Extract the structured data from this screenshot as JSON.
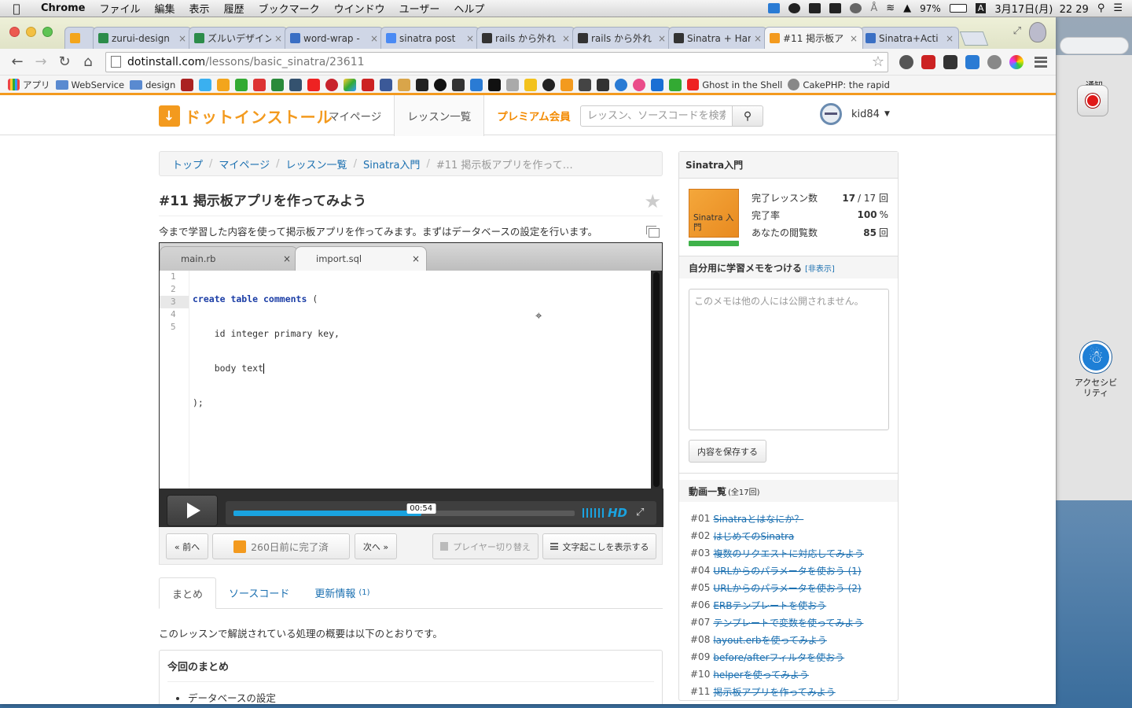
{
  "menubar": {
    "app": "Chrome",
    "items": [
      "ファイル",
      "編集",
      "表示",
      "履歴",
      "ブックマーク",
      "ウインドウ",
      "ユーザー",
      "ヘルプ"
    ],
    "battery": "97%",
    "input_indicator": "A",
    "datetime": "3月17日(月)  22 29"
  },
  "desktop": {
    "notify_label": "通知",
    "accessibility_label": "アクセシビリティ"
  },
  "tabs": [
    {
      "title": "zurui-design",
      "color": "#2c8c4a"
    },
    {
      "title": "ズルいデザイン",
      "color": "#2c8c4a"
    },
    {
      "title": "word-wrap -",
      "color": "#3a6fc4"
    },
    {
      "title": "sinatra post",
      "color": "#4a8af4"
    },
    {
      "title": "rails から外れ",
      "color": "#333333"
    },
    {
      "title": "rails から外れ",
      "color": "#333333"
    },
    {
      "title": "Sinatra + Har",
      "color": "#333333"
    },
    {
      "title": "#11 掲示板ア",
      "color": "#f39a1e",
      "active": true
    },
    {
      "title": "Sinatra+Acti",
      "color": "#3a6fc4"
    }
  ],
  "address_bar": {
    "host": "dotinstall.com",
    "path": "/lessons/basic_sinatra/23611"
  },
  "bookmarks": {
    "apps": "アプリ",
    "folders": [
      "WebService",
      "design"
    ],
    "ghost": "Ghost in the Shell",
    "cake": "CakePHP: the rapid"
  },
  "site": {
    "logo": "ドットインストール",
    "nav": {
      "mypage": "マイページ",
      "lessons": "レッスン一覧",
      "premium": "プレミアム会員"
    },
    "search_placeholder": "レッスン、ソースコードを検索",
    "user": "kid84"
  },
  "breadcrumb": [
    "トップ",
    "マイページ",
    "レッスン一覧",
    "Sinatra入門",
    "#11 掲示板アプリを作って…"
  ],
  "lesson": {
    "title": "#11 掲示板アプリを作ってみよう",
    "description": "今まで学習した内容を使って掲示板アプリを作ってみます。まずはデータベースの設定を行います。"
  },
  "player": {
    "tabs": [
      "main.rb",
      "import.sql"
    ],
    "code_lines": [
      "1",
      "2",
      "3",
      "4",
      "5"
    ],
    "time": "00:54",
    "progress": 0.55,
    "hd": "HD"
  },
  "buttons": {
    "prev": "« 前へ",
    "done": "260日前に完了済",
    "next": "次へ »",
    "switch_player": "プレイヤー切り替え",
    "transcript": "文字起こしを表示する"
  },
  "subtabs": {
    "summary": "まとめ",
    "source": "ソースコード",
    "updates": "更新情報",
    "updates_count": "(1)"
  },
  "summary": {
    "intro": "このレッスンで解説されている処理の概要は以下のとおりです。",
    "box_title": "今回のまとめ",
    "items": [
      "データベースの設定"
    ]
  },
  "sidebar": {
    "course_title": "Sinatra入門",
    "thumb_text": "Sinatra 入門",
    "stats": [
      {
        "label": "完了レッスン数",
        "value": "17",
        "suffix": "/ 17 回"
      },
      {
        "label": "完了率",
        "value": "100",
        "suffix": "%"
      },
      {
        "label": "あなたの閲覧数",
        "value": "85",
        "suffix": "回"
      }
    ],
    "memo_title": "自分用に学習メモをつける",
    "memo_hide": "[非表示]",
    "memo_placeholder": "このメモは他の人には公開されません。",
    "memo_save": "内容を保存する",
    "video_list_title": "動画一覧",
    "video_list_count": "(全17回)",
    "videos": [
      {
        "num": "#01",
        "title": "Sinatraとはなにか？"
      },
      {
        "num": "#02",
        "title": "はじめてのSinatra"
      },
      {
        "num": "#03",
        "title": "複数のリクエストに対応してみよう"
      },
      {
        "num": "#04",
        "title": "URLからのパラメータを使おう (1)"
      },
      {
        "num": "#05",
        "title": "URLからのパラメータを使おう (2)"
      },
      {
        "num": "#06",
        "title": "ERBテンプレートを使おう"
      },
      {
        "num": "#07",
        "title": "テンプレートで変数を使ってみよう"
      },
      {
        "num": "#08",
        "title": "layout.erbを使ってみよう"
      },
      {
        "num": "#09",
        "title": "before/afterフィルタを使おう"
      },
      {
        "num": "#10",
        "title": "helperを使ってみよう"
      },
      {
        "num": "#11",
        "title": "掲示板アプリを作ってみよう"
      }
    ]
  }
}
